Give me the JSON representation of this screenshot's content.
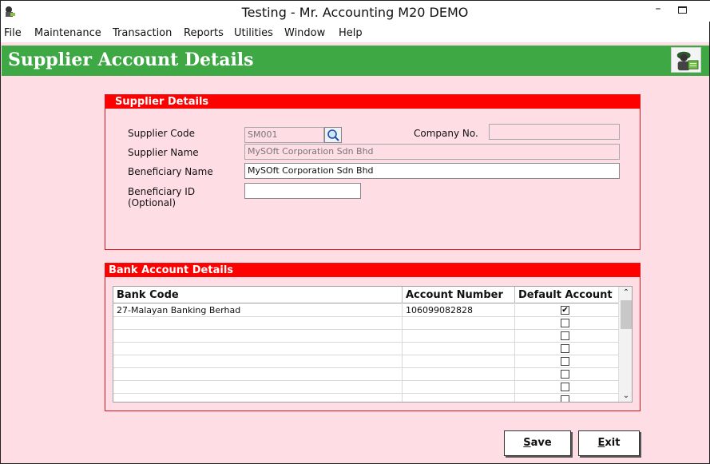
{
  "window": {
    "title": "Testing - Mr. Accounting M20 DEMO"
  },
  "menu": [
    "File",
    "Maintenance",
    "Transaction",
    "Reports",
    "Utilities",
    "Window",
    "Help"
  ],
  "header": {
    "title": "Supplier Account Details",
    "icon": "worker-icon"
  },
  "supplier": {
    "section_title": "Supplier Details",
    "code_label": "Supplier Code",
    "code_value": "SM001",
    "company_no_label": "Company No.",
    "company_no_value": "",
    "name_label": "Supplier Name",
    "name_value": "MySOft Corporation Sdn Bhd",
    "beneficiary_name_label": "Beneficiary Name",
    "beneficiary_name_value": "MySOft Corporation Sdn Bhd",
    "beneficiary_id_label": "Beneficiary ID",
    "beneficiary_id_label2": "(Optional)",
    "beneficiary_id_value": ""
  },
  "bank": {
    "section_title": "Bank Account Details",
    "columns": [
      "Bank Code",
      "Account Number",
      "Default Account"
    ],
    "rows": [
      {
        "bank_code": "27-Malayan Banking Berhad",
        "account_number": "106099082828",
        "default": true
      },
      {
        "bank_code": "",
        "account_number": "",
        "default": false
      },
      {
        "bank_code": "",
        "account_number": "",
        "default": false
      },
      {
        "bank_code": "",
        "account_number": "",
        "default": false
      },
      {
        "bank_code": "",
        "account_number": "",
        "default": false
      },
      {
        "bank_code": "",
        "account_number": "",
        "default": false
      },
      {
        "bank_code": "",
        "account_number": "",
        "default": false
      },
      {
        "bank_code": "",
        "account_number": "",
        "default": false
      }
    ]
  },
  "buttons": {
    "save": "Save",
    "exit": "Exit"
  },
  "colors": {
    "header_green": "#3ea845",
    "section_red": "#ff0000",
    "form_background": "#ffdde4"
  }
}
